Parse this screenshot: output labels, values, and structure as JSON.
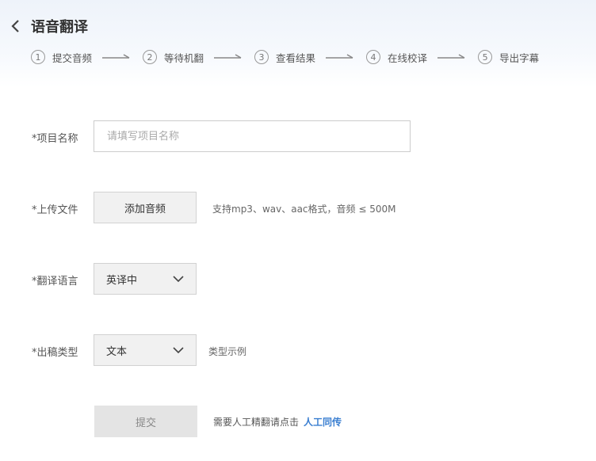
{
  "header": {
    "title": "语音翻译",
    "back_icon": "chevron-left-icon"
  },
  "steps": [
    {
      "num": "1",
      "label": "提交音频"
    },
    {
      "num": "2",
      "label": "等待机翻"
    },
    {
      "num": "3",
      "label": "查看结果"
    },
    {
      "num": "4",
      "label": "在线校译"
    },
    {
      "num": "5",
      "label": "导出字幕"
    }
  ],
  "form": {
    "project_name": {
      "label": "*项目名称",
      "value": "",
      "placeholder": "请填写项目名称"
    },
    "upload": {
      "label": "*上传文件",
      "button": "添加音频",
      "hint": "支持mp3、wav、aac格式，音频 ≤ 500M"
    },
    "language": {
      "label": "*翻译语言",
      "selected": "英译中"
    },
    "output_type": {
      "label": "*出稿类型",
      "selected": "文本",
      "hint": "类型示例"
    },
    "submit": {
      "label": "提交"
    },
    "note": {
      "text": "需要人工精翻请点击",
      "link": "人工同传"
    }
  },
  "colors": {
    "link": "#3b7fd1",
    "header_bg": "#eef3fa"
  }
}
